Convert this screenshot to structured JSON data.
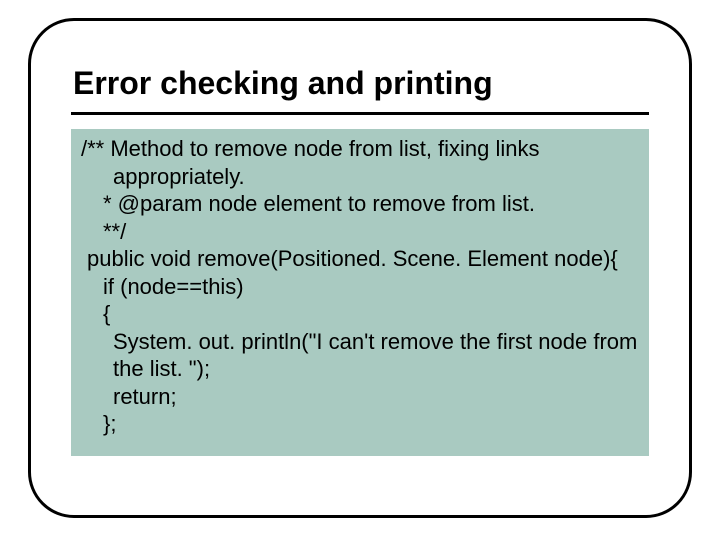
{
  "slide": {
    "title": "Error checking and printing",
    "code": {
      "l1": "/** Method to remove node from list, fixing links appropriately.",
      "l2": "* @param node element to remove from list.",
      "l3": "**/",
      "l4": "public void remove(Positioned. Scene. Element node){",
      "l5": "if (node==this)",
      "l6": "{",
      "l7": "System. out. println(\"I can't remove the first node from the list. \");",
      "l8": "return;",
      "l9": "};"
    }
  }
}
